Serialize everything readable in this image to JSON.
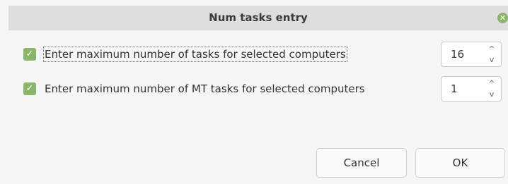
{
  "dialog": {
    "title": "Num tasks entry",
    "close_icon": "close-icon"
  },
  "rows": [
    {
      "checked": true,
      "label": "Enter maximum number of tasks for selected computers",
      "value": "16"
    },
    {
      "checked": true,
      "label": "Enter maximum number of MT tasks for selected computers",
      "value": "1"
    }
  ],
  "buttons": {
    "cancel_label": "Cancel",
    "ok_label": "OK"
  },
  "colors": {
    "accent": "#8ab56b",
    "titlebar": "#dedede",
    "background": "#f6f6f6"
  }
}
